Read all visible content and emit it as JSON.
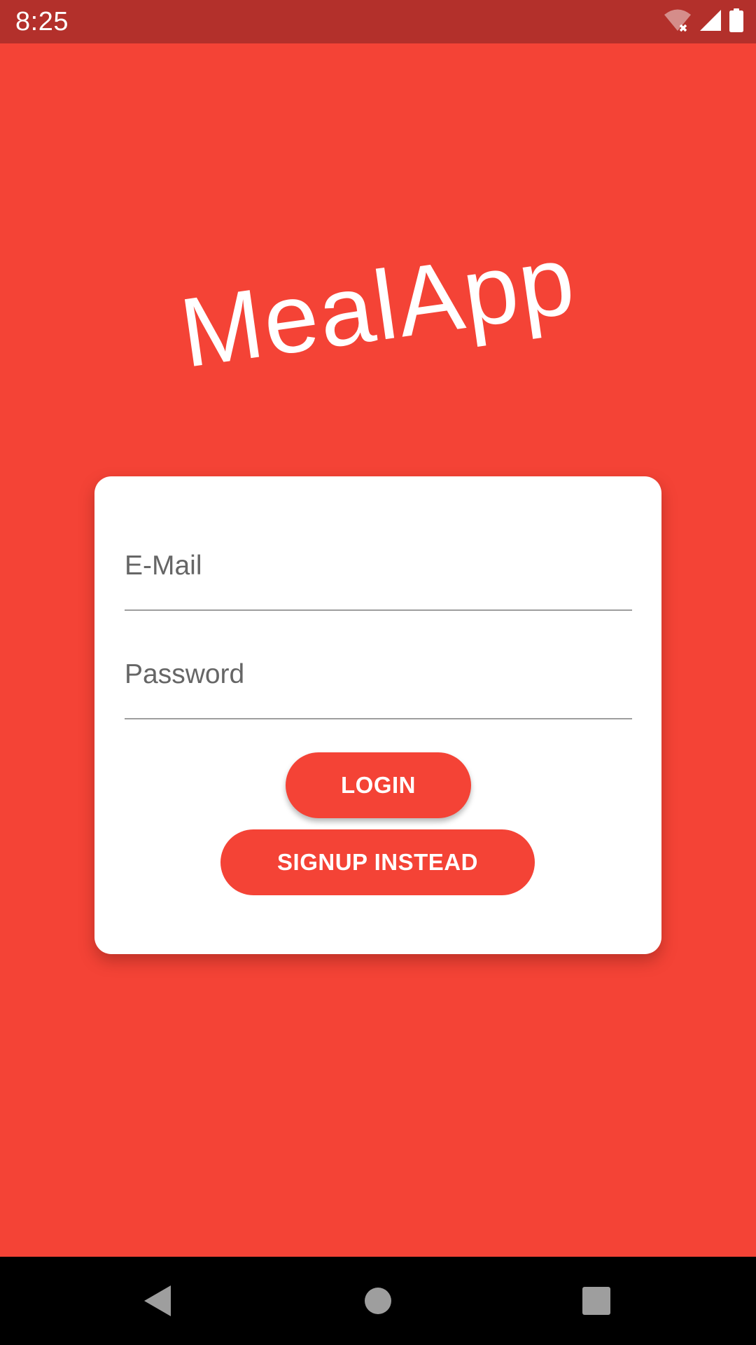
{
  "status_bar": {
    "time": "8:25",
    "icons": [
      "wifi-off-icon",
      "signal-icon",
      "battery-icon"
    ]
  },
  "app": {
    "title": "MealApp"
  },
  "login_form": {
    "email_placeholder": "E-Mail",
    "password_placeholder": "Password",
    "login_label": "LOGIN",
    "signup_label": "SIGNUP INSTEAD"
  },
  "nav_bar": {
    "icons": [
      "back-icon",
      "home-icon",
      "recents-icon"
    ]
  },
  "colors": {
    "background": "#F44336",
    "status_bar": "#B3302B",
    "card": "#FFFFFF",
    "button": "#F44336",
    "button_text": "#FFFFFF",
    "nav_bar": "#000000"
  }
}
